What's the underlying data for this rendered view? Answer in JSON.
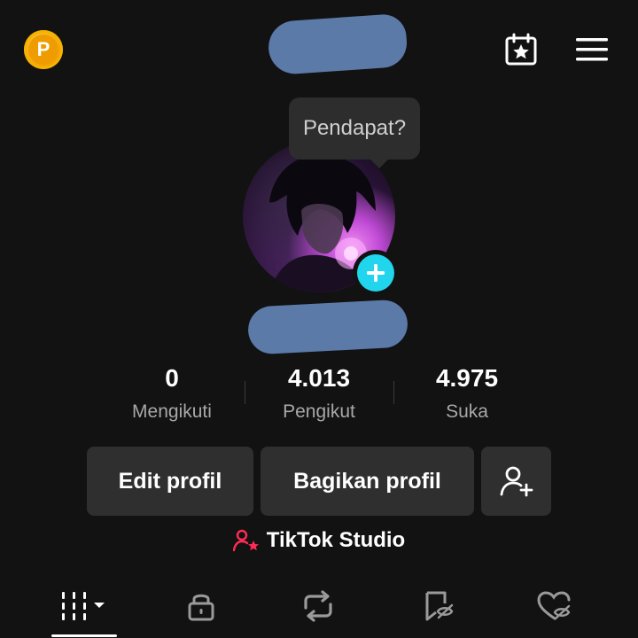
{
  "header": {
    "coin_letter": "P",
    "coin_icon": "coin-icon",
    "calendar_icon": "calendar-star-icon",
    "menu_icon": "hamburger-menu-icon"
  },
  "profile": {
    "tooltip_text": "Pendapat?",
    "avatar_icon": "avatar-image",
    "add_icon": "plus-icon"
  },
  "stats": [
    {
      "value": "0",
      "label": "Mengikuti"
    },
    {
      "value": "4.013",
      "label": "Pengikut"
    },
    {
      "value": "4.975",
      "label": "Suka"
    }
  ],
  "actions": {
    "edit_label": "Edit profil",
    "share_label": "Bagikan profil",
    "add_friend_icon": "add-user-icon"
  },
  "studio": {
    "label": "TikTok Studio",
    "icon": "user-star-icon",
    "icon_color": "#fe2c55"
  },
  "tabs": [
    {
      "name": "videos",
      "icon": "grid-bars-icon",
      "selected": true
    },
    {
      "name": "private",
      "icon": "lock-icon",
      "selected": false
    },
    {
      "name": "reposts",
      "icon": "repost-icon",
      "selected": false
    },
    {
      "name": "favorites",
      "icon": "bookmark-hidden-icon",
      "selected": false
    },
    {
      "name": "liked",
      "icon": "heart-hidden-icon",
      "selected": false
    }
  ],
  "colors": {
    "background": "#121212",
    "button": "#2f2f2f",
    "accent_cyan": "#20d5ec",
    "coin": "#f7a90c",
    "redaction": "#5b7aa8"
  }
}
